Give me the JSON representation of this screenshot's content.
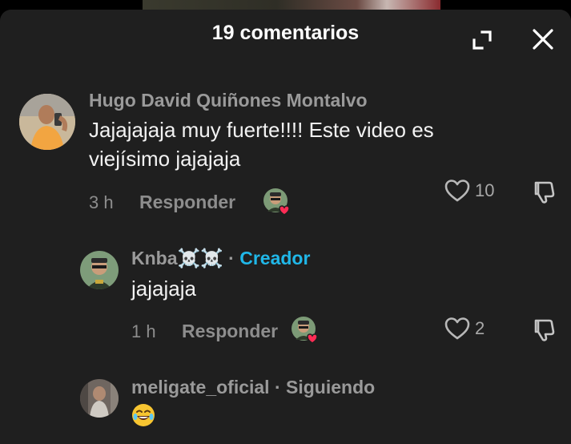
{
  "header": {
    "title": "19 comentarios",
    "expand_icon": "expand-icon",
    "close_icon": "close-icon"
  },
  "comments": [
    {
      "username": "Hugo David Quiñones Montalvo",
      "text_line1": "Jajajajaja muy fuerte!!!! Este video es",
      "text_line2": "viejísimo jajajaja",
      "time": "3 h",
      "reply_label": "Responder",
      "likes": "10"
    },
    {
      "username": "Knba☠️☠️",
      "separator": "·",
      "badge": "Creador",
      "text": "jajajaja",
      "time": "1 h",
      "reply_label": "Responder",
      "likes": "2"
    },
    {
      "username": "meligate_oficial",
      "separator": "·",
      "badge": "Siguiendo",
      "text": "😂"
    }
  ],
  "colors": {
    "sheet_bg": "#1f1f1f",
    "creator_badge": "#20b7e8",
    "muted_text": "#8d8d8d",
    "heart_red": "#fe2c55"
  }
}
